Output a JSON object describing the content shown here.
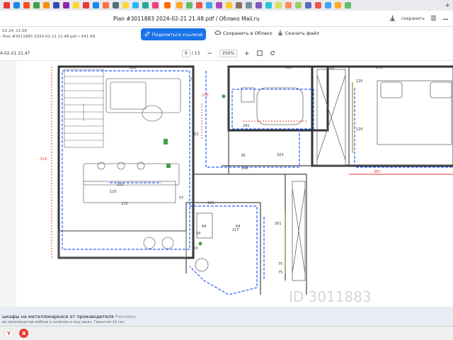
{
  "browser": {
    "tab_colors": [
      "#e53935",
      "#1e88e5",
      "#f4511e",
      "#43a047",
      "#fb8c00",
      "#3949ab",
      "#8e24aa",
      "#fdd835",
      "#e53935",
      "#1e88e5",
      "#ff7043",
      "#546e7a",
      "#fdd835",
      "#29b6f6",
      "#26a69a",
      "#ec407a",
      "#5c6bc0",
      "#ffa726",
      "#66bb6a",
      "#ef5350",
      "#42a5f5",
      "#ab47bc",
      "#ffca28",
      "#8d6e63",
      "#78909c",
      "#7e57c2",
      "#26c6da",
      "#d4e157",
      "#ff8a65",
      "#9ccc65",
      "#5c6bc0",
      "#ef5350",
      "#42a5f5",
      "#ffa726",
      "#66bb6a"
    ],
    "active_tab_color": "#ff6d00",
    "page_title": "Plan #3011883 2024-02-21 21.48.pdf / Облако Mail.ru",
    "save_label": "сохранить",
    "new_tab_symbol": "+"
  },
  "viewer": {
    "meta_line1": "02.24, 21.58",
    "meta_line2": "- Plan #3011883 2024-02-21 21.48.pdf • 641 КБ",
    "share_label": "Поделиться ссылкой",
    "save_cloud_label": "Сохранить в Облако",
    "download_label": "Скачать файл"
  },
  "pdf_toolbar": {
    "file_label": "4-02-21 21.47",
    "page_current": "9",
    "page_total": "/ 13",
    "zoom": "250%",
    "zoom_out_symbol": "−",
    "zoom_in_symbol": "+"
  },
  "plan": {
    "dims": [
      "225",
      "70",
      "165",
      "212",
      "172",
      "516",
      "270",
      "252",
      "120",
      "241",
      "120",
      "323",
      "387",
      "240",
      "81",
      "57",
      "120",
      "222",
      "120",
      "221",
      "34",
      "75",
      "117",
      "64",
      "261",
      "75",
      "94",
      "53"
    ],
    "watermark": "ID 3011883",
    "accent_blue": "#2962ff",
    "accent_red": "#e53935",
    "accent_green": "#43a047"
  },
  "ad": {
    "headline": "шкафы на металлокаркасе от производителя",
    "tag": "Реклама",
    "subline": "ие производстве мебели в наличии и под заказ. Гарантия 10 лет"
  }
}
